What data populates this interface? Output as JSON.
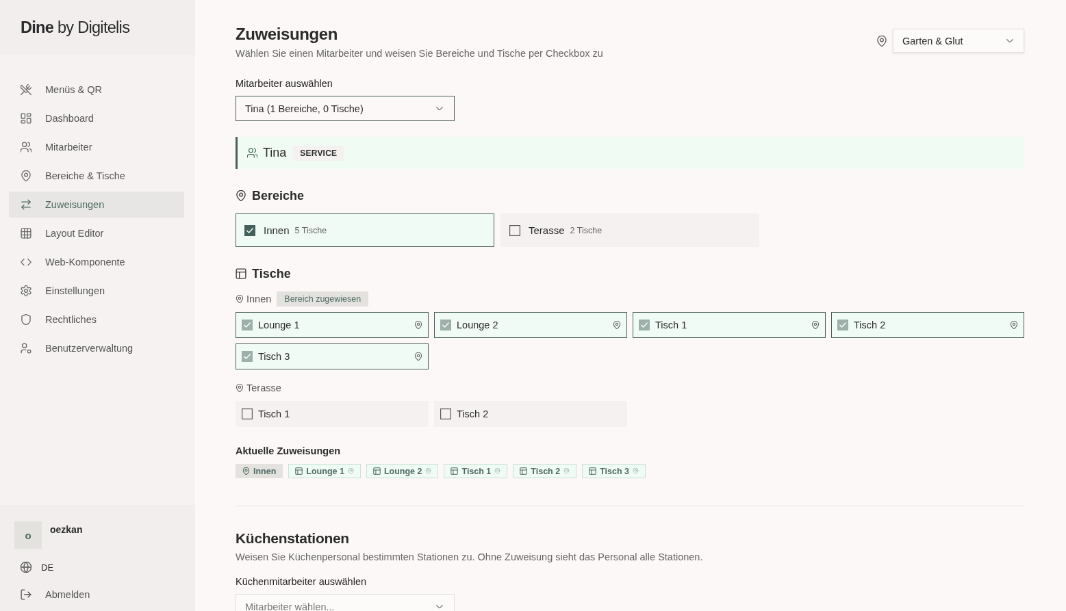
{
  "sidebar": {
    "logo": "**Dine** by Digitelis",
    "nav": [
      {
        "label": "Menüs & QR",
        "selected": false
      },
      {
        "label": "Dashboard",
        "selected": false
      },
      {
        "label": "Mitarbeiter",
        "selected": false
      },
      {
        "label": "Bereiche & Tische",
        "selected": false
      },
      {
        "label": "Zuweisungen",
        "selected": true
      },
      {
        "label": "Layout Editor",
        "selected": false
      },
      {
        "label": "Web-Komponente",
        "selected": false
      },
      {
        "label": "Einstellungen",
        "selected": false
      },
      {
        "label": "Rechtliches",
        "selected": false
      },
      {
        "label": "Benutzerverwaltung",
        "selected": false
      }
    ],
    "user": {
      "initial": "o",
      "name": "oezkan"
    },
    "language": "DE",
    "logout": "Abmelden"
  },
  "header": {
    "title": "Zuweisungen",
    "subtitle": "Wählen Sie einen Mitarbeiter und weisen Sie Bereiche und Tische per Checkbox zu",
    "restaurant_select": {
      "value": "Garten & Glut"
    }
  },
  "employee_select": {
    "label": "Mitarbeiter auswählen",
    "value": "Tina (1 Bereiche, 0 Tische)"
  },
  "employee": {
    "name": "Tina",
    "role": "SERVICE"
  },
  "areas": {
    "title": "Bereiche",
    "items": [
      {
        "name": "Innen",
        "count": "5 Tische",
        "checked": true
      },
      {
        "name": "Terasse",
        "count": "2 Tische",
        "checked": false
      }
    ]
  },
  "tables": {
    "title": "Tische",
    "groups": [
      {
        "area": "Innen",
        "badge": "Bereich zugewiesen",
        "items": [
          {
            "name": "Lounge 1",
            "checked": true,
            "disabled": true
          },
          {
            "name": "Lounge 2",
            "checked": true,
            "disabled": true
          },
          {
            "name": "Tisch 1",
            "checked": true,
            "disabled": true
          },
          {
            "name": "Tisch 2",
            "checked": true,
            "disabled": true
          },
          {
            "name": "Tisch 3",
            "checked": true,
            "disabled": true
          }
        ]
      },
      {
        "area": "Terasse",
        "items": [
          {
            "name": "Tisch 1",
            "checked": false,
            "disabled": false
          },
          {
            "name": "Tisch 2",
            "checked": false,
            "disabled": false
          }
        ]
      }
    ]
  },
  "current_assignments": {
    "title": "Aktuelle Zuweisungen",
    "chips": [
      {
        "kind": "area",
        "label": "Innen",
        "via_area": false
      },
      {
        "kind": "table",
        "label": "Lounge 1",
        "via_area": true
      },
      {
        "kind": "table",
        "label": "Lounge 2",
        "via_area": true
      },
      {
        "kind": "table",
        "label": "Tisch 1",
        "via_area": true
      },
      {
        "kind": "table",
        "label": "Tisch 2",
        "via_area": true
      },
      {
        "kind": "table",
        "label": "Tisch 3",
        "via_area": true
      }
    ]
  },
  "kitchen": {
    "title": "Küchenstationen",
    "subtitle": "Weisen Sie Küchenpersonal bestimmten Stationen zu. Ohne Zuweisung sieht das Personal alle Stationen.",
    "select": {
      "label": "Küchenmitarbeiter auswählen",
      "placeholder": "Mitarbeiter wählen..."
    }
  }
}
